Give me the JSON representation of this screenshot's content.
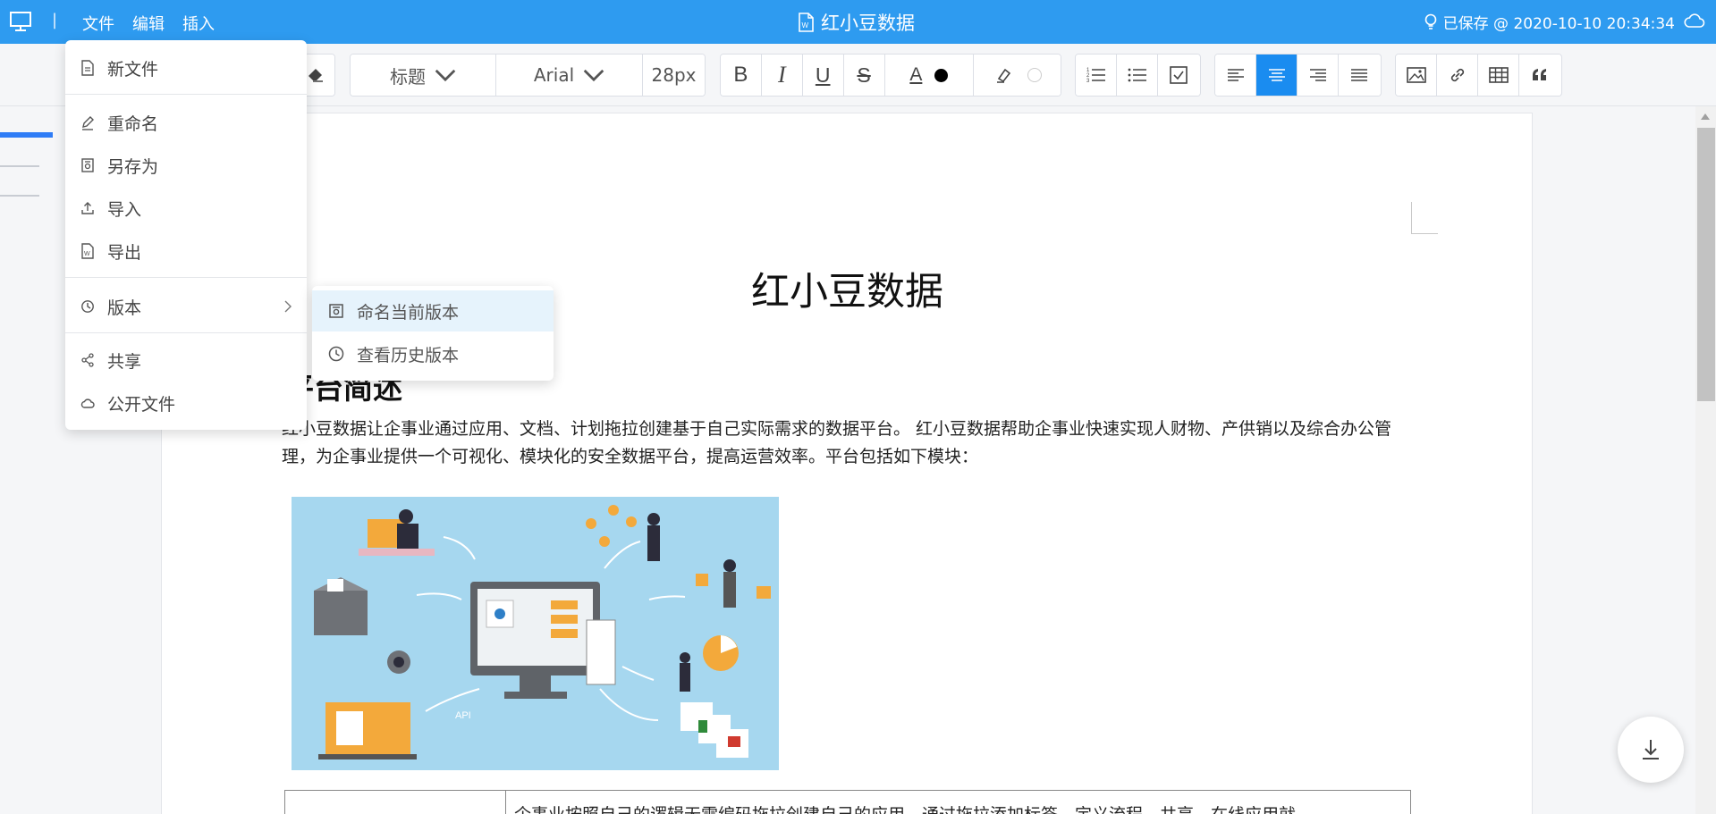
{
  "titlebar": {
    "menus": [
      "文件",
      "编辑",
      "插入"
    ],
    "separator": "|",
    "doc_title": "红小豆数据",
    "save_status": "已保存 @ 2020-10-10 20:34:34",
    "bg_color": "#2e9bf0"
  },
  "toolbar": {
    "heading_select": "标题",
    "font_select": "Arial",
    "font_size": "28px",
    "bold": "B",
    "italic": "I",
    "underline": "U",
    "strike": "S",
    "font_color_label": "A",
    "active_align": "center",
    "accent_color": "#1a8cf0"
  },
  "file_menu": {
    "items": [
      {
        "label": "新文件",
        "icon": "file-icon"
      },
      {
        "label": "重命名",
        "icon": "edit-icon"
      },
      {
        "label": "另存为",
        "icon": "save-icon"
      },
      {
        "label": "导入",
        "icon": "upload-icon"
      },
      {
        "label": "导出",
        "icon": "export-icon"
      },
      {
        "label": "版本",
        "icon": "history-icon"
      },
      {
        "label": "共享",
        "icon": "share-icon"
      },
      {
        "label": "公开文件",
        "icon": "cloud-icon"
      }
    ]
  },
  "version_submenu": {
    "items": [
      {
        "label": "命名当前版本",
        "icon": "save-icon"
      },
      {
        "label": "查看历史版本",
        "icon": "history-icon"
      }
    ]
  },
  "document": {
    "title": "红小豆数据",
    "heading": "平台简述",
    "paragraph": "红小豆数据让企事业通过应用、文档、计划拖拉创建基于自己实际需求的数据平台。 红小豆数据帮助企事业快速实现人财物、产供销以及综合办公管理，为企事业提供一个可视化、模块化的安全数据平台，提高运营效率。平台包括如下模块：",
    "image_labels": {
      "api": "API"
    },
    "table_row_text": "企事业按照自己的逻辑无需编码拖拉创建自己的应用，通过拖拉添加标签，定义流程，共享，在线应用就"
  }
}
